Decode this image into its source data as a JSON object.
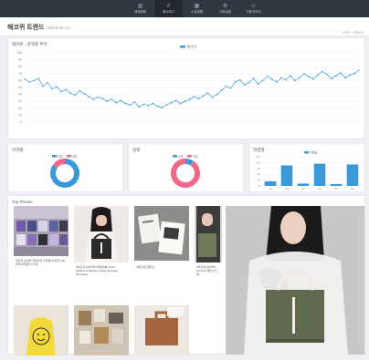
{
  "nav": {
    "items": [
      {
        "label": "매체현황",
        "icon": "chart-icon"
      },
      {
        "label": "해시태그",
        "icon": "hash-icon"
      },
      {
        "label": "수집현황",
        "icon": "grid-icon"
      },
      {
        "label": "사용설정",
        "icon": "gear-icon"
      },
      {
        "label": "사용자관리",
        "icon": "user-icon"
      }
    ],
    "active_index": 1
  },
  "page": {
    "title": "해코퀴 트렌드",
    "date": "(2018.06.11)",
    "breadcrumb": "트렌드 > 해코퀴"
  },
  "line_card": {
    "title": "해코퀴 - 검색량 추이",
    "legend": "해코퀴"
  },
  "gender_card": {
    "title": "지역별",
    "legend": [
      "남성",
      "여성"
    ]
  },
  "age_card": {
    "title": "성별",
    "legend": [
      "남성",
      "여성"
    ]
  },
  "bar_card": {
    "title": "연령별",
    "legend": "연령별"
  },
  "photos_card": {
    "title": "Top Photos",
    "captions": [
      "해코퀴 쇼퍼백 데일리백 추천템 #해코퀴 #쇼퍼백 #데일리 #가방",
      "#해코퀴 #쇼퍼백 #데일리룩 #ootd #dailylook #fashion #bag #shopper #kocabag",
      "#해코퀴스튜디오",
      "#해코퀴 #쇼퍼백 #ootd #가방스타그램",
      "해코퀴 캔버스 토트백 신상 입고 #해코퀴"
    ]
  },
  "chart_data": [
    {
      "type": "line",
      "title": "해코퀴 - 검색량 추이",
      "series": [
        {
          "name": "해코퀴",
          "values": [
            62,
            58,
            60,
            63,
            52,
            57,
            48,
            51,
            44,
            47,
            42,
            39,
            45,
            41,
            37,
            33,
            36,
            34,
            30,
            33,
            28,
            31,
            27,
            25,
            29,
            22,
            26,
            24,
            27,
            23,
            21,
            25,
            28,
            31,
            27,
            30,
            33,
            37,
            34,
            38,
            42,
            36,
            40,
            46,
            52,
            49,
            58,
            61,
            54,
            57,
            63,
            55,
            60,
            66,
            62,
            58,
            64,
            61,
            67,
            60,
            64,
            70,
            66,
            62,
            68,
            73,
            69,
            63,
            67,
            71,
            64,
            68,
            70,
            75
          ]
        }
      ],
      "ylim": [
        0,
        100
      ],
      "yticks": [
        0,
        10,
        20,
        30,
        40,
        50,
        60,
        70,
        80,
        90,
        100
      ],
      "grid": true
    },
    {
      "type": "pie",
      "title": "지역별",
      "categories": [
        "남성",
        "여성"
      ],
      "values": [
        85,
        15
      ],
      "colors": [
        "#3a9ad9",
        "#f2678a"
      ]
    },
    {
      "type": "pie",
      "title": "성별",
      "categories": [
        "남성",
        "여성"
      ],
      "values": [
        9,
        91
      ],
      "colors": [
        "#3a9ad9",
        "#f2678a"
      ]
    },
    {
      "type": "bar",
      "title": "연령별",
      "categories": [
        "10",
        "20",
        "30",
        "40",
        "50",
        "60"
      ],
      "values": [
        20,
        88,
        10,
        95,
        8,
        92
      ],
      "ylim": [
        0,
        125
      ],
      "yticks": [
        0,
        25,
        50,
        75,
        100,
        125
      ],
      "color": "#3a9ad9"
    }
  ]
}
